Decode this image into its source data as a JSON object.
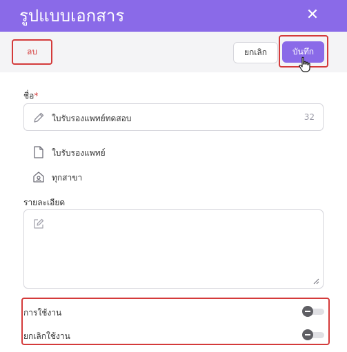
{
  "dialog": {
    "title": "รูปแบบเอกสาร",
    "close_icon": "close-icon"
  },
  "toolbar": {
    "delete_label": "ลบ",
    "cancel_label": "ยกเลิก",
    "save_label": "บันทึก"
  },
  "form": {
    "name_label": "ชื่อ",
    "required_mark": "*",
    "name_value": "ใบรับรองแพทย์ทดสอบ",
    "name_remaining": "32",
    "document_type": "ใบรับรองแพทย์",
    "branch": "ทุกสาขา",
    "description_label": "รายละเอียด",
    "description_value": ""
  },
  "status": {
    "active_label": "การใช้งาน",
    "active_on": false,
    "inactive_label": "ยกเลิกใช้งาน",
    "inactive_on": false
  },
  "colors": {
    "accent": "#8a6ae8",
    "danger": "#d43a3a"
  }
}
